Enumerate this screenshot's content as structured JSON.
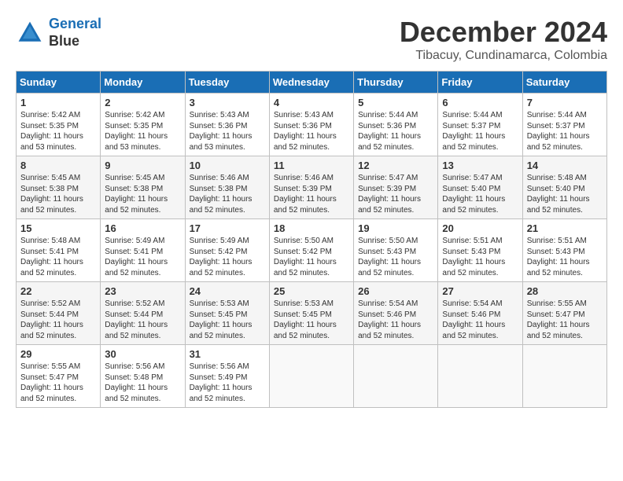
{
  "logo": {
    "line1": "General",
    "line2": "Blue"
  },
  "title": "December 2024",
  "subtitle": "Tibacuy, Cundinamarca, Colombia",
  "days_of_week": [
    "Sunday",
    "Monday",
    "Tuesday",
    "Wednesday",
    "Thursday",
    "Friday",
    "Saturday"
  ],
  "weeks": [
    [
      {
        "day": "1",
        "sunrise": "5:42 AM",
        "sunset": "5:35 PM",
        "daylight": "11 hours and 53 minutes."
      },
      {
        "day": "2",
        "sunrise": "5:42 AM",
        "sunset": "5:35 PM",
        "daylight": "11 hours and 53 minutes."
      },
      {
        "day": "3",
        "sunrise": "5:43 AM",
        "sunset": "5:36 PM",
        "daylight": "11 hours and 53 minutes."
      },
      {
        "day": "4",
        "sunrise": "5:43 AM",
        "sunset": "5:36 PM",
        "daylight": "11 hours and 52 minutes."
      },
      {
        "day": "5",
        "sunrise": "5:44 AM",
        "sunset": "5:36 PM",
        "daylight": "11 hours and 52 minutes."
      },
      {
        "day": "6",
        "sunrise": "5:44 AM",
        "sunset": "5:37 PM",
        "daylight": "11 hours and 52 minutes."
      },
      {
        "day": "7",
        "sunrise": "5:44 AM",
        "sunset": "5:37 PM",
        "daylight": "11 hours and 52 minutes."
      }
    ],
    [
      {
        "day": "8",
        "sunrise": "5:45 AM",
        "sunset": "5:38 PM",
        "daylight": "11 hours and 52 minutes."
      },
      {
        "day": "9",
        "sunrise": "5:45 AM",
        "sunset": "5:38 PM",
        "daylight": "11 hours and 52 minutes."
      },
      {
        "day": "10",
        "sunrise": "5:46 AM",
        "sunset": "5:38 PM",
        "daylight": "11 hours and 52 minutes."
      },
      {
        "day": "11",
        "sunrise": "5:46 AM",
        "sunset": "5:39 PM",
        "daylight": "11 hours and 52 minutes."
      },
      {
        "day": "12",
        "sunrise": "5:47 AM",
        "sunset": "5:39 PM",
        "daylight": "11 hours and 52 minutes."
      },
      {
        "day": "13",
        "sunrise": "5:47 AM",
        "sunset": "5:40 PM",
        "daylight": "11 hours and 52 minutes."
      },
      {
        "day": "14",
        "sunrise": "5:48 AM",
        "sunset": "5:40 PM",
        "daylight": "11 hours and 52 minutes."
      }
    ],
    [
      {
        "day": "15",
        "sunrise": "5:48 AM",
        "sunset": "5:41 PM",
        "daylight": "11 hours and 52 minutes."
      },
      {
        "day": "16",
        "sunrise": "5:49 AM",
        "sunset": "5:41 PM",
        "daylight": "11 hours and 52 minutes."
      },
      {
        "day": "17",
        "sunrise": "5:49 AM",
        "sunset": "5:42 PM",
        "daylight": "11 hours and 52 minutes."
      },
      {
        "day": "18",
        "sunrise": "5:50 AM",
        "sunset": "5:42 PM",
        "daylight": "11 hours and 52 minutes."
      },
      {
        "day": "19",
        "sunrise": "5:50 AM",
        "sunset": "5:43 PM",
        "daylight": "11 hours and 52 minutes."
      },
      {
        "day": "20",
        "sunrise": "5:51 AM",
        "sunset": "5:43 PM",
        "daylight": "11 hours and 52 minutes."
      },
      {
        "day": "21",
        "sunrise": "5:51 AM",
        "sunset": "5:43 PM",
        "daylight": "11 hours and 52 minutes."
      }
    ],
    [
      {
        "day": "22",
        "sunrise": "5:52 AM",
        "sunset": "5:44 PM",
        "daylight": "11 hours and 52 minutes."
      },
      {
        "day": "23",
        "sunrise": "5:52 AM",
        "sunset": "5:44 PM",
        "daylight": "11 hours and 52 minutes."
      },
      {
        "day": "24",
        "sunrise": "5:53 AM",
        "sunset": "5:45 PM",
        "daylight": "11 hours and 52 minutes."
      },
      {
        "day": "25",
        "sunrise": "5:53 AM",
        "sunset": "5:45 PM",
        "daylight": "11 hours and 52 minutes."
      },
      {
        "day": "26",
        "sunrise": "5:54 AM",
        "sunset": "5:46 PM",
        "daylight": "11 hours and 52 minutes."
      },
      {
        "day": "27",
        "sunrise": "5:54 AM",
        "sunset": "5:46 PM",
        "daylight": "11 hours and 52 minutes."
      },
      {
        "day": "28",
        "sunrise": "5:55 AM",
        "sunset": "5:47 PM",
        "daylight": "11 hours and 52 minutes."
      }
    ],
    [
      {
        "day": "29",
        "sunrise": "5:55 AM",
        "sunset": "5:47 PM",
        "daylight": "11 hours and 52 minutes."
      },
      {
        "day": "30",
        "sunrise": "5:56 AM",
        "sunset": "5:48 PM",
        "daylight": "11 hours and 52 minutes."
      },
      {
        "day": "31",
        "sunrise": "5:56 AM",
        "sunset": "5:49 PM",
        "daylight": "11 hours and 52 minutes."
      },
      null,
      null,
      null,
      null
    ]
  ]
}
